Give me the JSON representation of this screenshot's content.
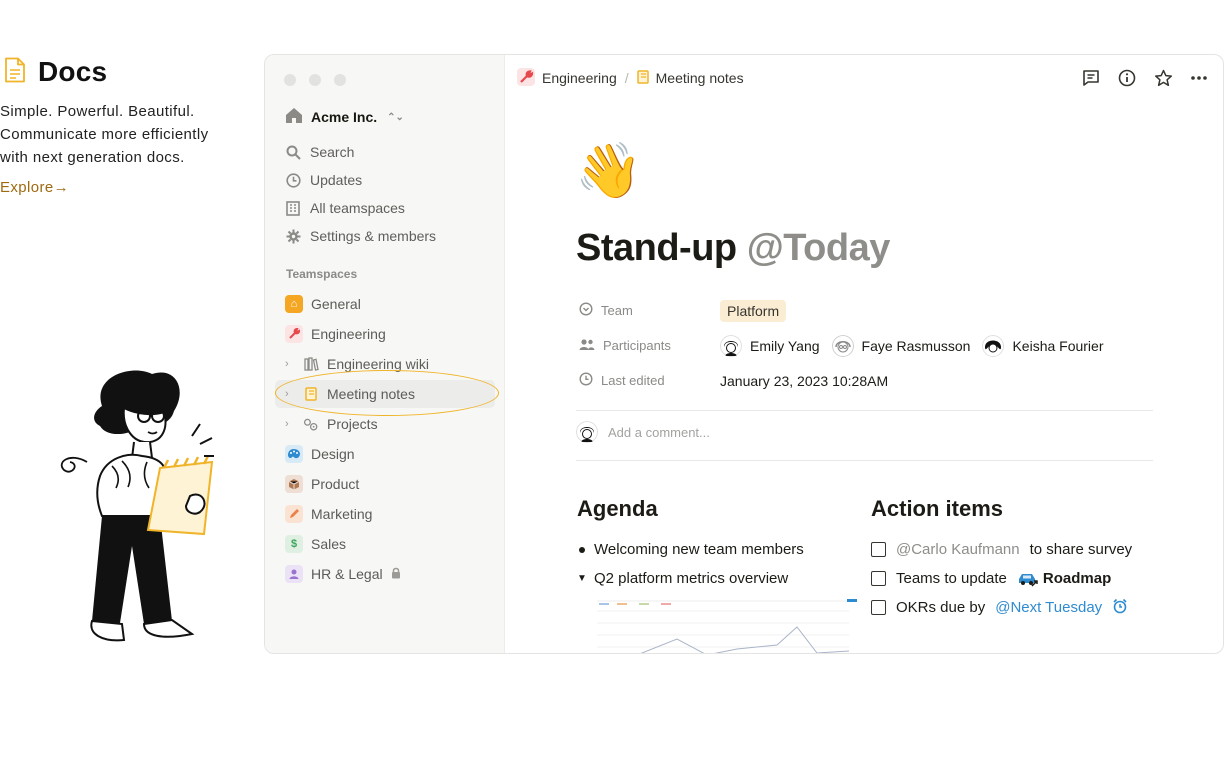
{
  "intro": {
    "title": "Docs",
    "description_lines": [
      "Simple. Powerful. Beautiful.",
      "Communicate more efficiently",
      "with next generation docs."
    ],
    "link": "Explore→",
    "accent": "#f0b429"
  },
  "sidebar": {
    "workspace": "Acme Inc.",
    "nav": [
      {
        "label": "Search",
        "icon": "search-icon"
      },
      {
        "label": "Updates",
        "icon": "clock-icon"
      },
      {
        "label": "All teamspaces",
        "icon": "building-icon"
      },
      {
        "label": "Settings & members",
        "icon": "gear-icon"
      }
    ],
    "teamspaces_label": "Teamspaces",
    "teamspaces": [
      {
        "label": "General",
        "icon": "home-icon",
        "color": "#f5a623"
      },
      {
        "label": "Engineering",
        "icon": "wrench-icon",
        "color": "#e5484d"
      },
      {
        "label": "Engineering wiki",
        "icon": "books-icon"
      },
      {
        "label": "Meeting notes",
        "icon": "notebook-icon",
        "color": "#f0b429"
      },
      {
        "label": "Projects",
        "icon": "gears-icon"
      },
      {
        "label": "Design",
        "icon": "palette-icon",
        "color": "#2f8bd0"
      },
      {
        "label": "Product",
        "icon": "box-icon",
        "color": "#b07a55"
      },
      {
        "label": "Marketing",
        "icon": "pencil-icon",
        "color": "#e8814a"
      },
      {
        "label": "Sales",
        "icon": "dollar-icon",
        "color": "#3aa65a"
      },
      {
        "label": "HR & Legal",
        "icon": "person-icon",
        "color": "#9b72cf"
      }
    ]
  },
  "main": {
    "breadcrumb": [
      "Engineering",
      "Meeting notes"
    ],
    "emoji": "👋",
    "title": "Stand-up",
    "title_mention": "@Today",
    "properties": {
      "team_label": "Team",
      "team_value": "Platform",
      "participants_label": "Participants",
      "participants": [
        "Emily Yang",
        "Faye Rasmusson",
        "Keisha Fourier"
      ],
      "last_edited_label": "Last edited",
      "last_edited_value": "January 23, 2023 10:28AM"
    },
    "comment_placeholder": "Add a comment...",
    "agenda": {
      "title": "Agenda",
      "items": [
        "Welcoming new team members",
        "Q2 platform metrics overview"
      ]
    },
    "action_items": {
      "title": "Action items",
      "item1_mention": "@Carlo Kaufmann",
      "item1_text": "to share survey",
      "item2_text": "Teams to update",
      "item2_link": "Roadmap",
      "item3_text": "OKRs due by",
      "item3_mention": "@Next Tuesday"
    }
  }
}
